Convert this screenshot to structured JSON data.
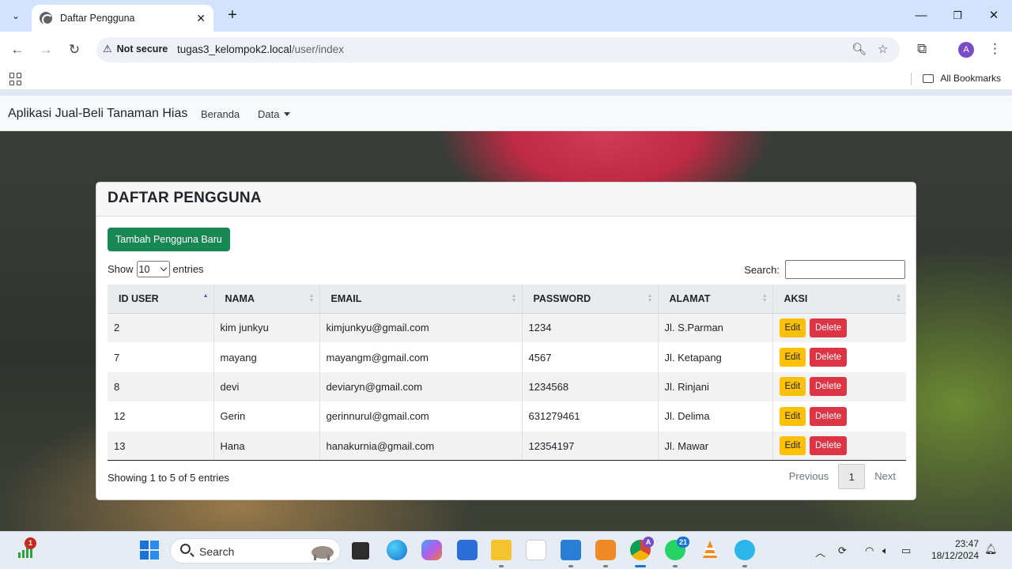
{
  "browser": {
    "tab_title": "Daftar Pengguna",
    "security_label": "Not secure",
    "url_host": "tugas3_kelompok2.local",
    "url_path": "/user/index",
    "profile_initial": "A",
    "all_bookmarks": "All Bookmarks"
  },
  "navbar": {
    "brand": "Aplikasi Jual-Beli Tanaman Hias",
    "links": [
      "Beranda",
      "Data"
    ]
  },
  "card": {
    "title": "DAFTAR PENGGUNA",
    "add_button": "Tambah Pengguna Baru",
    "show_label": "Show",
    "entries_label": "entries",
    "page_length": "10",
    "search_label": "Search:",
    "search_value": ""
  },
  "table": {
    "columns": [
      "ID USER",
      "NAMA",
      "EMAIL",
      "PASSWORD",
      "ALAMAT",
      "AKSI"
    ],
    "edit_label": "Edit",
    "delete_label": "Delete",
    "rows": [
      {
        "id": "2",
        "nama": "kim junkyu",
        "email": "kimjunkyu@gmail.com",
        "password": "1234",
        "alamat": "Jl. S.Parman"
      },
      {
        "id": "7",
        "nama": "mayang",
        "email": "mayangm@gmail.com",
        "password": "4567",
        "alamat": "Jl. Ketapang"
      },
      {
        "id": "8",
        "nama": "devi",
        "email": "deviaryn@gmail.com",
        "password": "1234568",
        "alamat": "Jl. Rinjani"
      },
      {
        "id": "12",
        "nama": "Gerin",
        "email": "gerinnurul@gmail.com",
        "password": "631279461",
        "alamat": "Jl. Delima"
      },
      {
        "id": "13",
        "nama": "Hana",
        "email": "hanakurnia@gmail.com",
        "password": "12354197",
        "alamat": "Jl. Mawar"
      }
    ],
    "info": "Showing 1 to 5 of 5 entries",
    "prev": "Previous",
    "current_page": "1",
    "next": "Next"
  },
  "taskbar": {
    "search_placeholder": "Search",
    "time": "23:47",
    "date": "18/12/2024",
    "widget_badge": "1",
    "whatsapp_badge": "21",
    "chrome_badge": "A"
  },
  "colors": {
    "success": "#198754",
    "warning": "#ffc107",
    "danger": "#dc3545",
    "tabstrip": "#d3e3fd"
  }
}
